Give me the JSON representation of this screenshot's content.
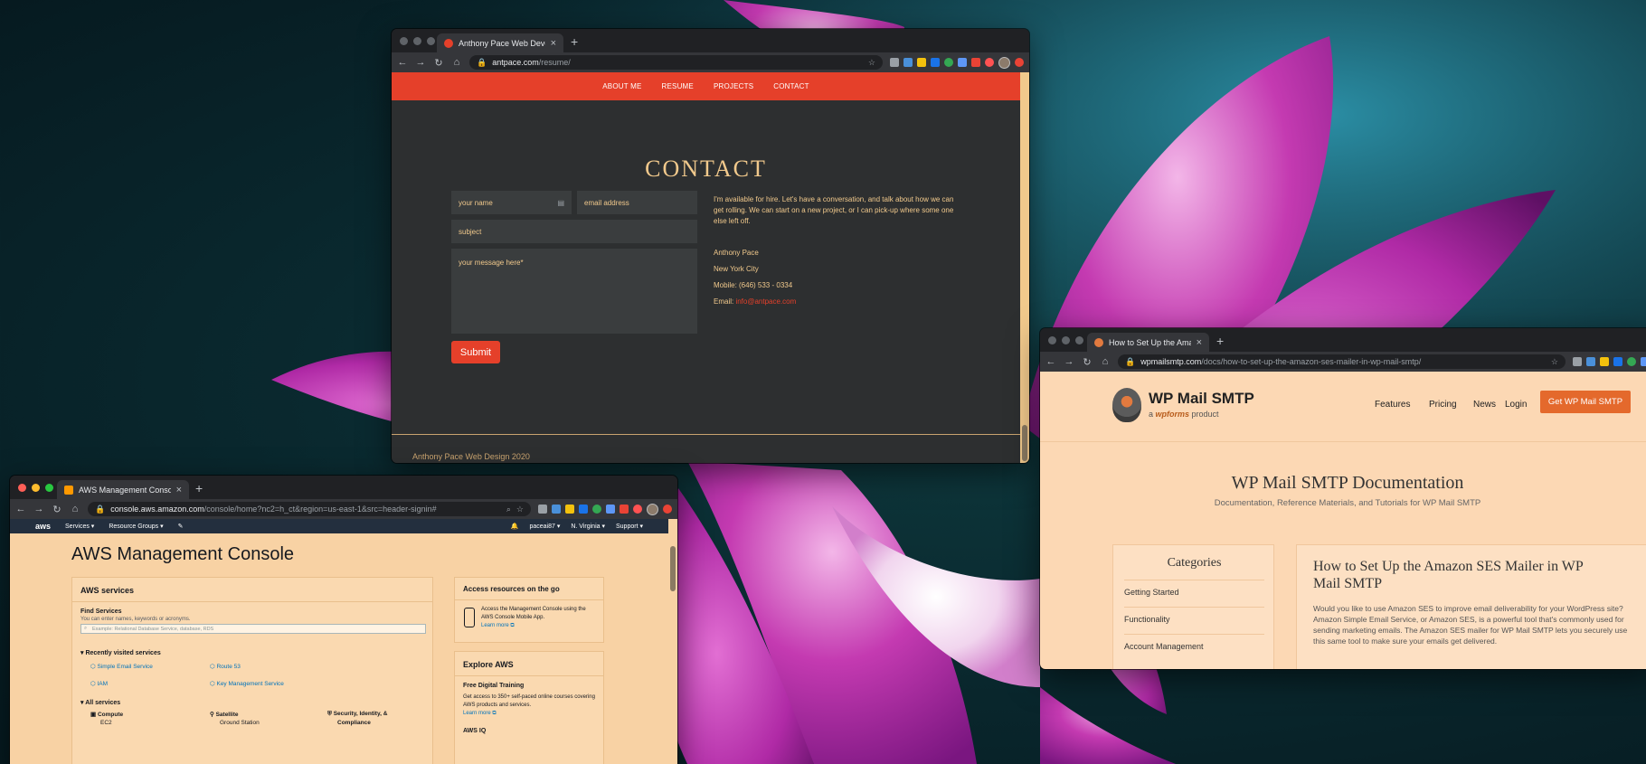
{
  "windows": {
    "antpace": {
      "tab_title": "Anthony Pace Web Developme",
      "url_host": "antpace.com",
      "url_path": "/resume/",
      "nav": [
        "ABOUT ME",
        "RESUME",
        "PROJECTS",
        "CONTACT"
      ],
      "section_title": "CONTACT",
      "form": {
        "name_placeholder": "your name",
        "email_placeholder": "email address",
        "subject_placeholder": "subject",
        "message_placeholder": "your message here*",
        "submit_label": "Submit"
      },
      "intro": "I'm available for hire. Let's have a conversation, and talk about how we can get rolling. We can start on a new project, or I can pick-up where some one else left off.",
      "contact": {
        "name": "Anthony Pace",
        "city": "New York City",
        "mobile": "Mobile: (646) 533 - 0334",
        "email_label": "Email: ",
        "email": "info@antpace.com"
      },
      "footer": "Anthony Pace Web Design 2020"
    },
    "aws": {
      "tab_title": "AWS Management Console",
      "url_host": "console.aws.amazon.com",
      "url_path": "/console/home?nc2=h_ct&region=us-east-1&src=header-signin#",
      "topbar": {
        "logo": "aws",
        "services": "Services",
        "resource_groups": "Resource Groups",
        "account": "paceai87",
        "region": "N. Virginia",
        "support": "Support"
      },
      "title": "AWS Management Console",
      "services_card": {
        "heading": "AWS services",
        "find_heading": "Find Services",
        "find_sub": "You can enter names, keywords or acronyms.",
        "search_placeholder": "Example: Relational Database Service, database, RDS",
        "recent_heading": "Recently visited services",
        "recent": [
          "Simple Email Service",
          "Route 53",
          "IAM",
          "Key Management Service"
        ],
        "all_heading": "All services",
        "all": [
          "Compute",
          "EC2",
          "Satellite",
          "Ground Station",
          "Security, Identity, &",
          "Compliance"
        ]
      },
      "go_card": {
        "heading": "Access resources on the go",
        "text": "Access the Management Console using the AWS Console Mobile App.",
        "link": "Learn more"
      },
      "explore_card": {
        "heading": "Explore AWS",
        "training_heading": "Free Digital Training",
        "training_text": "Get access to 350+ self-paced online courses covering AWS products and services.",
        "link": "Learn more",
        "iq": "AWS IQ"
      }
    },
    "wpmail": {
      "tab_title": "How to Set Up the Amazon SE",
      "url_host": "wpmailsmtp.com",
      "url_path": "/docs/how-to-set-up-the-amazon-ses-mailer-in-wp-mail-smtp/",
      "logo": "WP Mail SMTP",
      "logo_sub_a": "a ",
      "logo_sub_brand": "wpforms",
      "logo_sub_b": " product",
      "menu": [
        "Features",
        "Pricing",
        "News",
        "Login"
      ],
      "cta": "Get WP Mail SMTP",
      "doc_title": "WP Mail SMTP Documentation",
      "doc_sub": "Documentation, Reference Materials, and Tutorials for WP Mail SMTP",
      "categories_heading": "Categories",
      "categories": [
        "Getting Started",
        "Functionality",
        "Account Management"
      ],
      "article_title": "How to Set Up the Amazon SES Mailer in WP Mail SMTP",
      "article_text": "Would you like to use Amazon SES to improve email deliverability for your WordPress site? Amazon Simple Email Service, or Amazon SES, is a powerful tool that's commonly used for sending marketing emails. The Amazon SES mailer for WP Mail SMTP lets you securely use this same tool to make sure your emails get delivered."
    }
  },
  "colors": {
    "ant_accent": "#e5402a",
    "ant_text": "#f1c98c",
    "aws_link": "#0073bb",
    "wp_cta": "#e4692c"
  },
  "icons": [
    "back-icon",
    "forward-icon",
    "reload-icon",
    "home-icon",
    "lock-icon",
    "star-icon",
    "close-icon",
    "plus-icon",
    "search-icon",
    "phone-icon",
    "external-link-icon",
    "bell-icon"
  ]
}
